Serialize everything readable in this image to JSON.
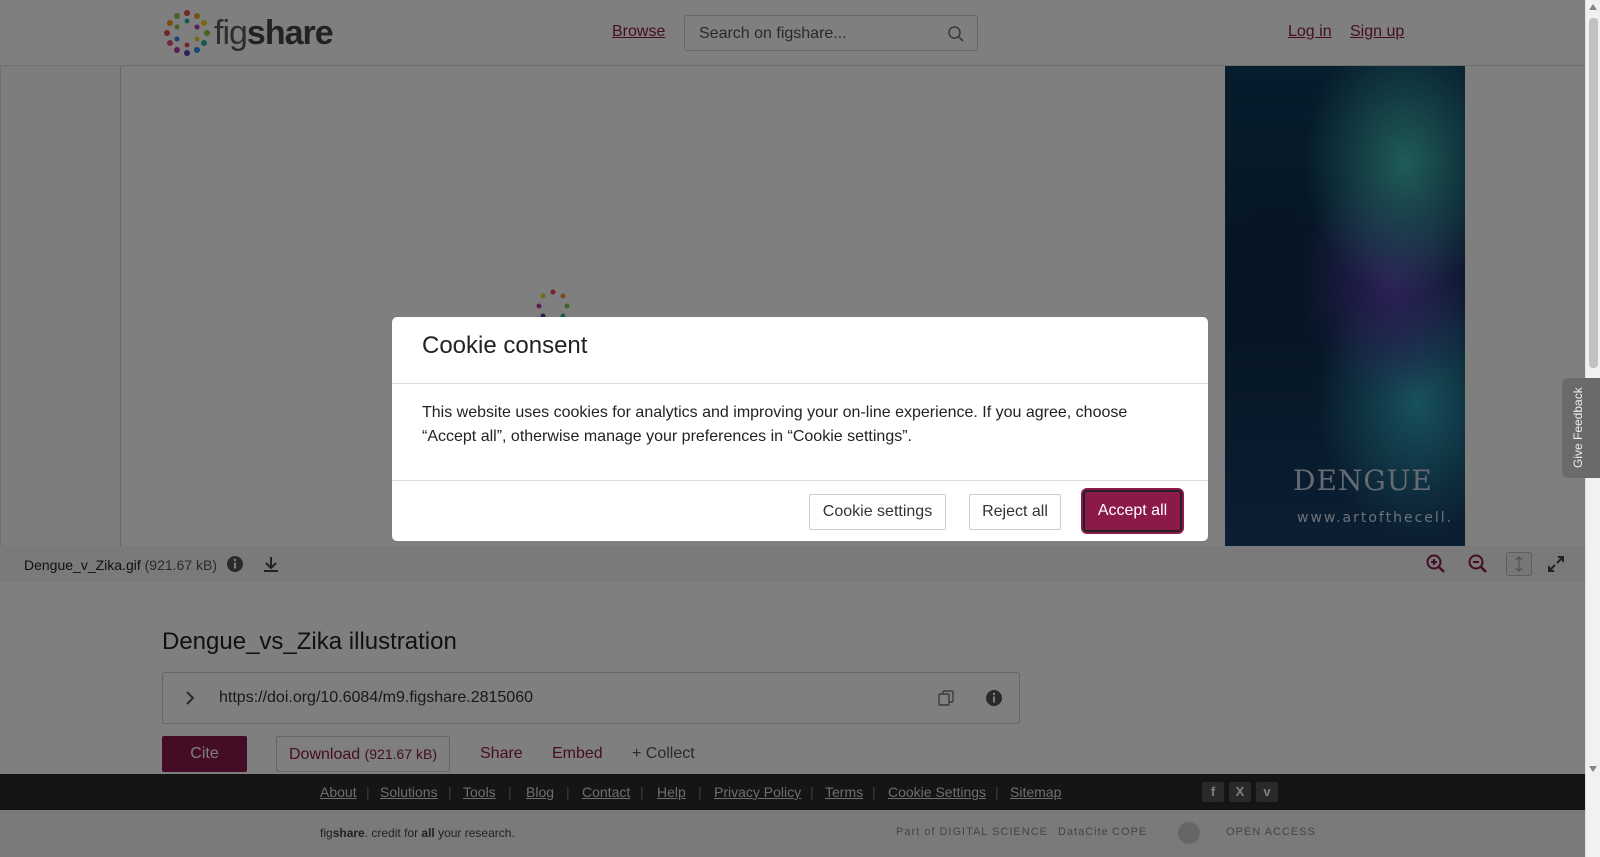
{
  "header": {
    "logo_text_light": "fig",
    "logo_text_bold": "share",
    "browse": "Browse",
    "search_placeholder": "Search on figshare...",
    "login": "Log in",
    "signup": "Sign up"
  },
  "viewer": {
    "art_title": "DENGUE",
    "art_url": "www.artofthecell.",
    "file_name": "Dengue_v_Zika.gif",
    "file_size": "(921.67 kB)"
  },
  "item": {
    "title": "Dengue_vs_Zika illustration",
    "doi": "https://doi.org/10.6084/m9.figshare.2815060",
    "cite": "Cite",
    "download_label": "Download",
    "download_size": "(921.67 kB)",
    "share": "Share",
    "embed": "Embed",
    "collect": "+ Collect"
  },
  "footer": {
    "links": [
      "About",
      "Solutions",
      "Tools",
      "Blog",
      "Contact",
      "Help",
      "Privacy Policy",
      "Terms",
      "Cookie Settings",
      "Sitemap"
    ],
    "tagline_pre": "fig",
    "tagline_bold": "share",
    "tagline_mid": ". credit for ",
    "tagline_all": "all",
    "tagline_post": " your research.",
    "partners": [
      "Part of DIGITAL SCIENCE",
      "DataCite",
      "COPE",
      "",
      "OPEN ACCESS"
    ]
  },
  "feedback": "Give Feedback",
  "modal": {
    "title": "Cookie consent",
    "body": "This website uses cookies for analytics and improving your on-line experience. If you agree, choose “Accept all”, otherwise manage your preferences in “Cookie settings”.",
    "cookie_settings": "Cookie settings",
    "reject_all": "Reject all",
    "accept_all": "Accept all"
  },
  "colors": {
    "brand": "#8b1a4a",
    "overlay": "rgba(0,0,0,0.5)",
    "footer_dark": "#2b2b2b"
  }
}
